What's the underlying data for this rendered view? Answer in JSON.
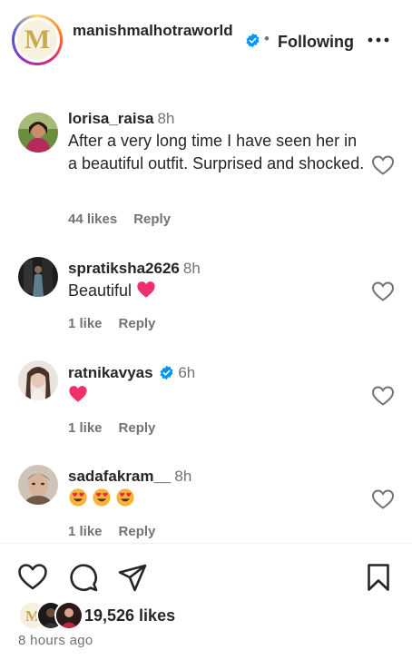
{
  "header": {
    "username": "manishmalhotraworld",
    "logo_letter": "M",
    "separator": "•",
    "follow_status": "Following"
  },
  "comments": [
    {
      "username": "lorisa_raisa",
      "time": "8h",
      "text": "After a very long time I have seen her in a beautiful outfit. Surprised and shocked.",
      "likes": "44 likes",
      "reply": "Reply",
      "verified": false
    },
    {
      "username": "spratiksha2626",
      "time": "8h",
      "text": "Beautiful",
      "emoji": [
        "heart"
      ],
      "likes": "1 like",
      "reply": "Reply",
      "verified": false
    },
    {
      "username": "ratnikavyas",
      "time": "6h",
      "text": "",
      "emoji": [
        "heart"
      ],
      "likes": "1 like",
      "reply": "Reply",
      "verified": true
    },
    {
      "username": "sadafakram__",
      "time": "8h",
      "text": "",
      "emoji": [
        "heart-eyes",
        "heart-eyes",
        "heart-eyes"
      ],
      "likes": "1 like",
      "reply": "Reply",
      "verified": false
    }
  ],
  "post": {
    "likes": "19,526 likes",
    "time_ago": "8 hours ago"
  },
  "icons": {
    "verified": "verified-badge-icon",
    "more": "more-options-icon",
    "heart": "heart-outline-icon",
    "comment": "comment-icon",
    "share": "share-icon",
    "save": "bookmark-icon"
  },
  "colors": {
    "verified_blue": "#0095f6",
    "emoji_heart": "#f0306a",
    "secondary_text": "#737373"
  }
}
